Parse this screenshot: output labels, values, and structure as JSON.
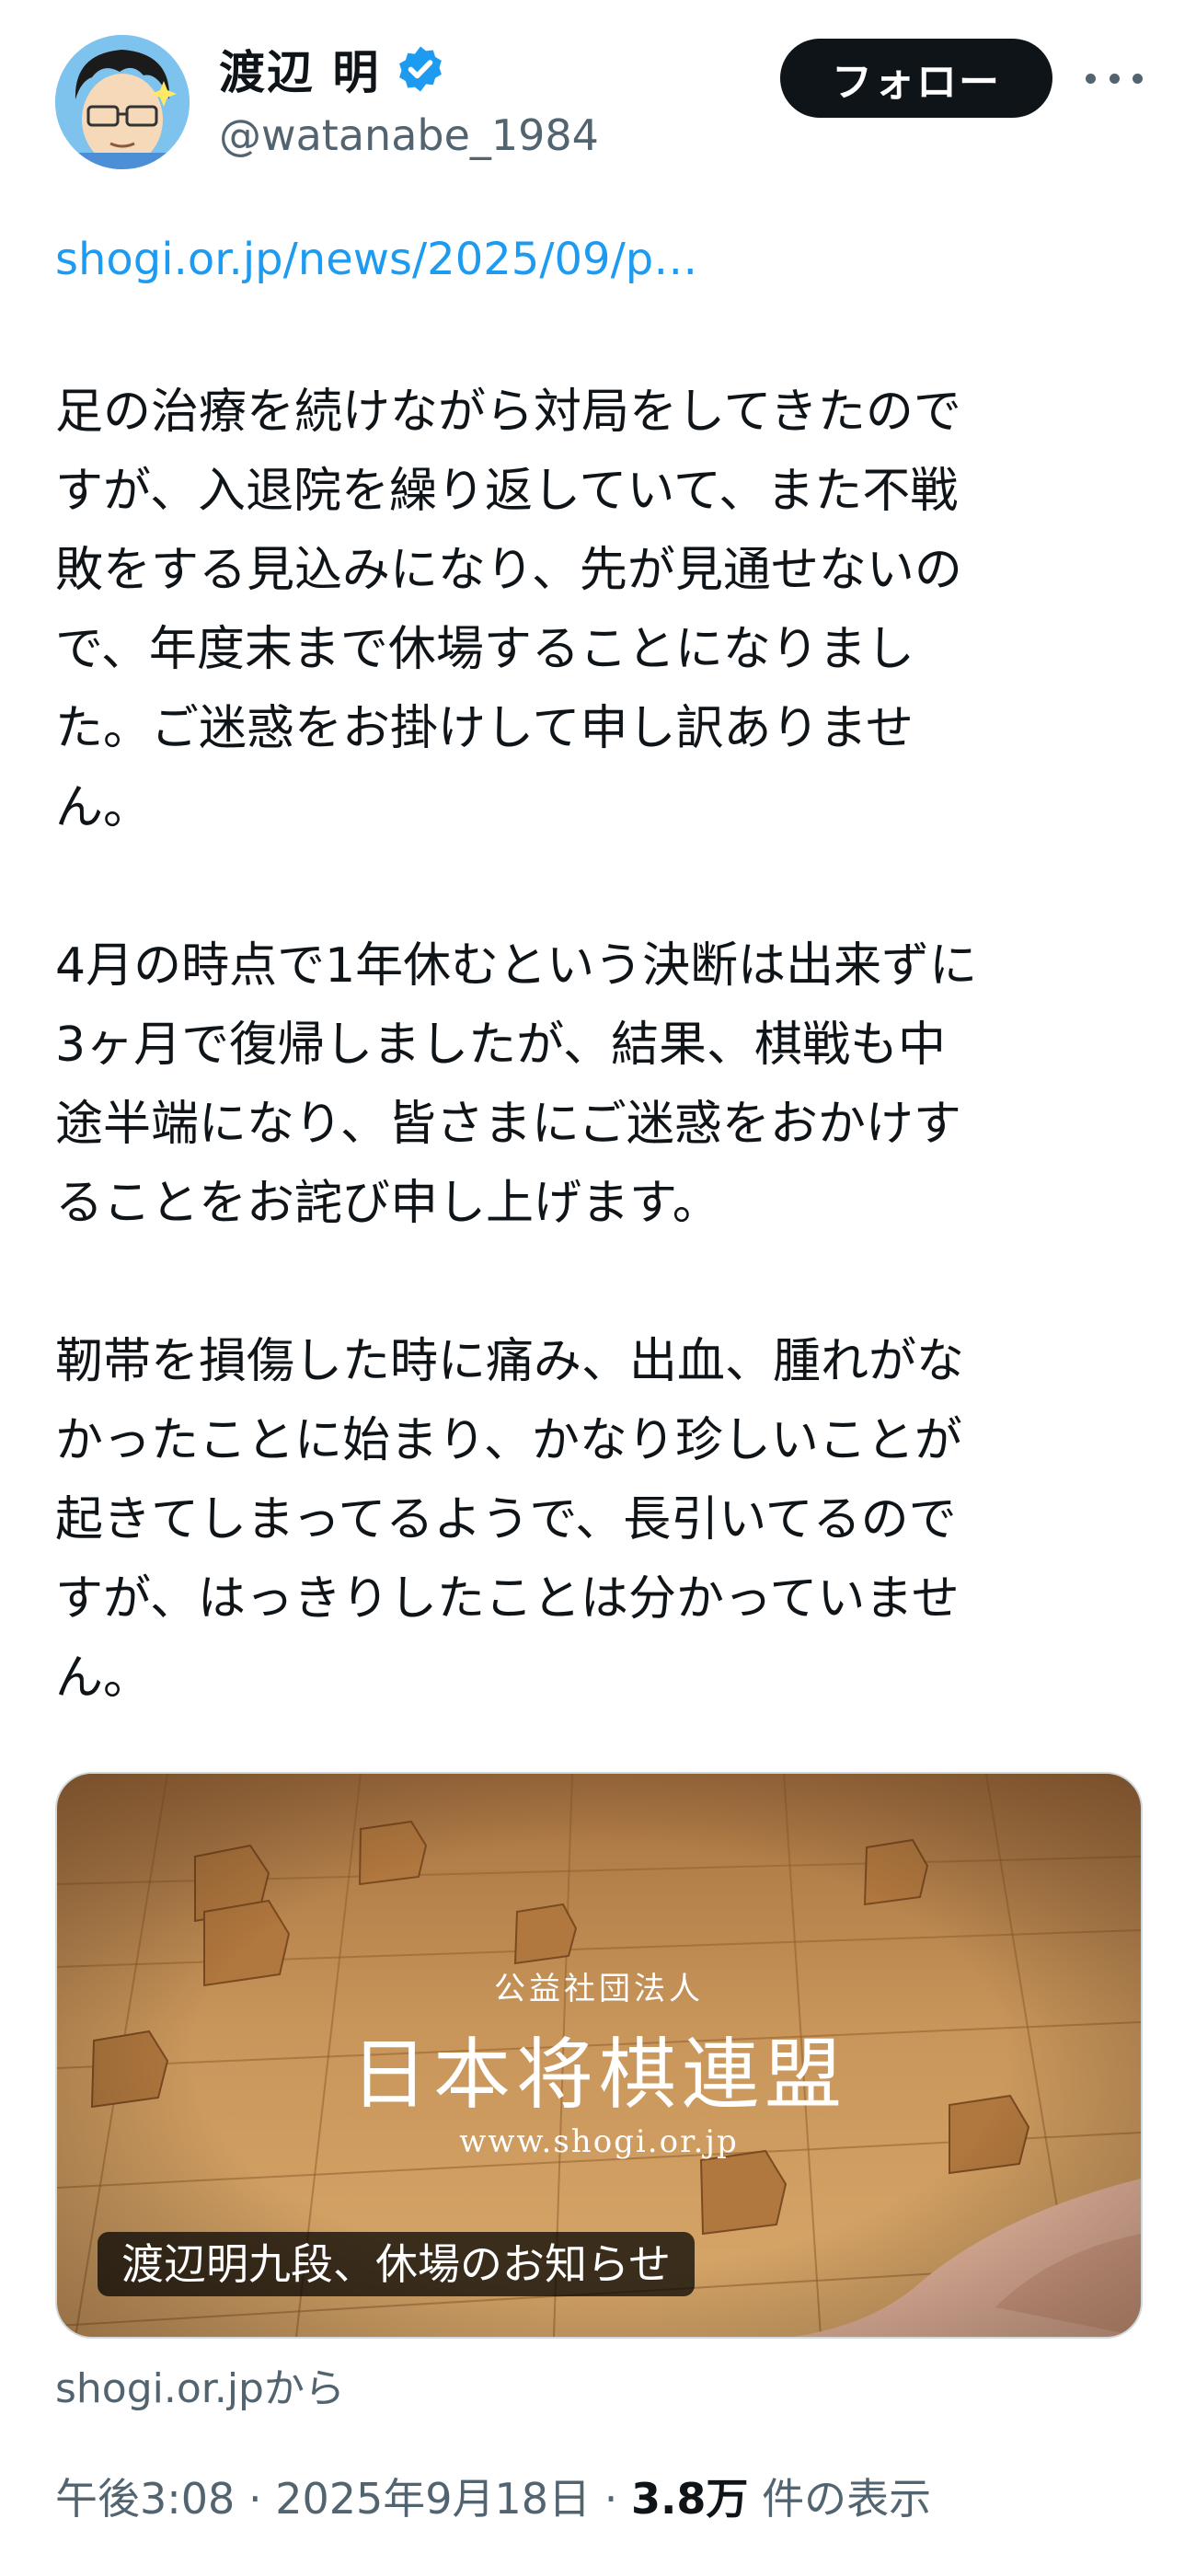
{
  "author": {
    "display_name": "渡辺 明",
    "handle": "@watanabe_1984",
    "verified_icon": "verified-badge-icon",
    "avatar_icon": "avatar-illustration"
  },
  "actions": {
    "follow_label": "フォロー",
    "more_icon": "more-options-icon"
  },
  "tweet": {
    "link_text": "shogi.or.jp/news/2025/09/p…",
    "lines": [
      "足の治療を続けながら対局をしてきたので",
      "すが、入退院を繰り返していて、また不戦",
      "敗をする見込みになり、先が見通せないの",
      "で、年度末まで休場することになりまし",
      "た。ご迷惑をお掛けして申し訳ありませ",
      "ん。",
      "",
      "4月の時点で1年休むという決断は出来ずに",
      "3ヶ月で復帰しましたが、結果、棋戦も中",
      "途半端になり、皆さまにご迷惑をおかけす",
      "ることをお詫び申し上げます。",
      "",
      "靭帯を損傷した時に痛み、出血、腫れがな",
      "かったことに始まり、かなり珍しいことが",
      "起きてしまってるようで、長引いてるので",
      "すが、はっきりしたことは分かっていませ",
      "ん。"
    ]
  },
  "card": {
    "image_subtitle": "公益社団法人",
    "image_title": "日本将棋連盟",
    "image_url": "www.shogi.or.jp",
    "title": "渡辺明九段、休場のお知らせ",
    "source": "shogi.or.jpから"
  },
  "meta": {
    "time": "午後3:08",
    "separator": "·",
    "date": "2025年9月18日",
    "views_count": "3.8万",
    "views_label": "件の表示"
  },
  "colors": {
    "link": "#1d9bf0",
    "secondary_text": "#536471",
    "follow_button_bg": "#0f1419",
    "verified_badge": "#1d9bf0",
    "card_board": "#c89656"
  }
}
